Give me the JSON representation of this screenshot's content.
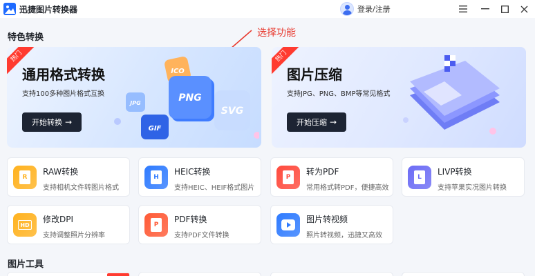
{
  "window": {
    "app_title": "迅捷图片转换器",
    "login_label": "登录/注册",
    "menu_icon": "hamburger-icon",
    "minimize_icon": "minimize-icon",
    "maximize_icon": "maximize-icon",
    "close_icon": "close-icon"
  },
  "annotation": {
    "text": "选择功能",
    "color": "#e83a2f"
  },
  "featured": {
    "section_title": "特色转换",
    "cards": [
      {
        "tag": "热门",
        "title": "通用格式转换",
        "subtitle": "支持100多种图片格式互换",
        "button": "开始转换",
        "art_labels": [
          "ICO",
          "PNG",
          "JPG",
          "SVG",
          "GIF"
        ]
      },
      {
        "tag": "热门",
        "title": "图片压缩",
        "subtitle": "支持JPG、PNG、BMP等常见格式",
        "button": "开始压缩"
      }
    ]
  },
  "tools": [
    {
      "name": "RAW转换",
      "desc": "支持相机文件转图片格式",
      "icon_letter": "R",
      "color": "#ffb21f",
      "icon": "raw-file-icon"
    },
    {
      "name": "HEIC转换",
      "desc": "支持HEIC、HEIF格式图片",
      "icon_letter": "H",
      "color": "#2f7bff",
      "icon": "heic-file-icon"
    },
    {
      "name": "转为PDF",
      "desc": "常用格式转PDF，便捷高效",
      "icon_letter": "P",
      "color": "#ff4a3d",
      "icon": "pdf-file-icon"
    },
    {
      "name": "LIVP转换",
      "desc": "支持苹果实况图片转换",
      "icon_letter": "L",
      "color": "#6c6cf5",
      "icon": "livp-file-icon"
    },
    {
      "name": "修改DPI",
      "desc": "支持调整照片分辨率",
      "icon_letter": "HD",
      "color": "#ffb21f",
      "icon": "hd-icon"
    },
    {
      "name": "PDF转换",
      "desc": "支持PDF文件转换",
      "icon_letter": "P",
      "color": "#ff5a36",
      "icon": "pdf-convert-icon"
    },
    {
      "name": "图片转视频",
      "desc": "照片转视频，迅捷又高效",
      "icon_letter": "",
      "color": "#2f7bff",
      "icon": "video-play-icon"
    }
  ],
  "tools_section2": {
    "title": "图片工具"
  }
}
